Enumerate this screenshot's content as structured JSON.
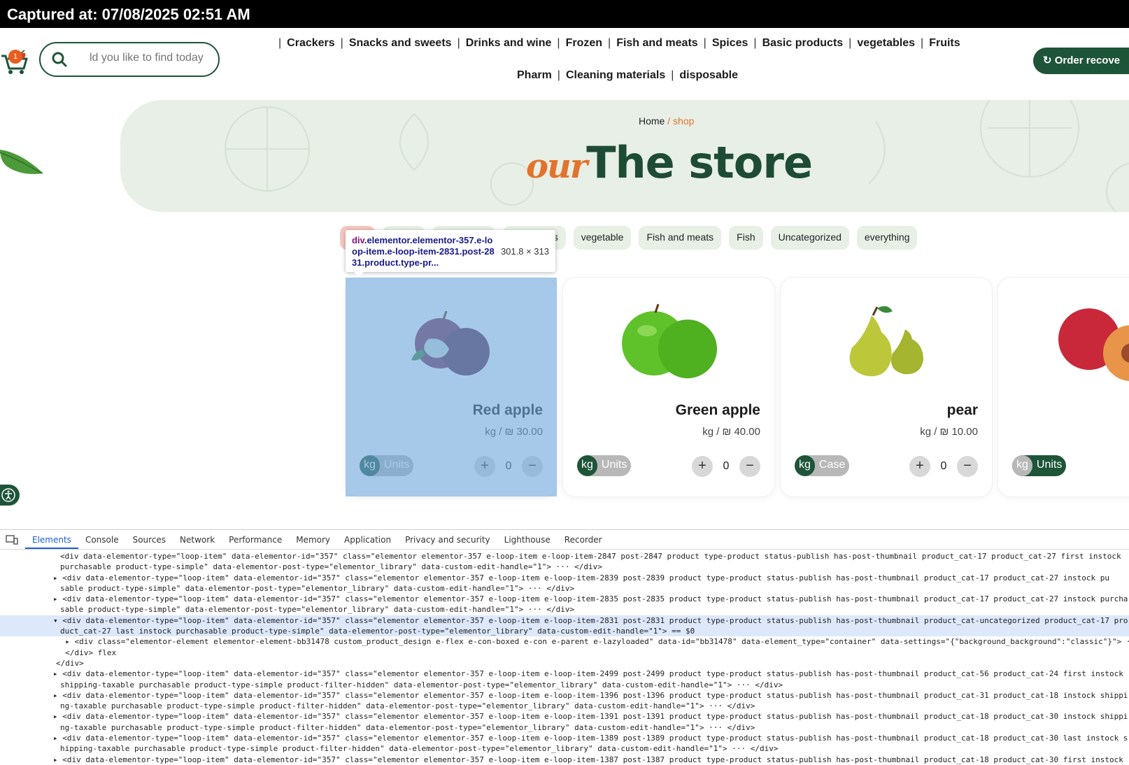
{
  "capture_banner": "Captured at: 07/08/2025 02:51 AM",
  "header": {
    "cart_count": "1",
    "search_placeholder": "ld you like to find today",
    "nav_row1": [
      "Crackers",
      "Snacks and sweets",
      "Drinks and wine",
      "Frozen",
      "Fish and meats",
      "Spices",
      "Basic products",
      "vegetables",
      "Fruits"
    ],
    "nav_row2": [
      "Pharm",
      "Cleaning materials",
      "disposable"
    ],
    "order_button": "Order recove"
  },
  "hero": {
    "breadcrumb_home": "Home",
    "breadcrumb_sep": " / ",
    "breadcrumb_current": "shop",
    "title_our": "our",
    "title_main": "The store"
  },
  "filters": [
    "",
    "",
    "s",
    "vegetables",
    "vegetable",
    "Fish and meats",
    "Fish",
    "Uncategorized",
    "everything"
  ],
  "products": [
    {
      "name": "Red apple",
      "price": "kg / ₪ 30.00",
      "units": [
        "kg",
        "Units"
      ],
      "qty": "0",
      "plus": "+",
      "minus": "−"
    },
    {
      "name": "Green apple",
      "price": "kg / ₪ 40.00",
      "units": [
        "kg",
        "Units"
      ],
      "qty": "0",
      "plus": "+",
      "minus": "−"
    },
    {
      "name": "pear",
      "price": "kg / ₪ 10.00",
      "units": [
        "kg",
        "Case"
      ],
      "qty": "0",
      "plus": "+",
      "minus": "−"
    },
    {
      "name": "",
      "price": "",
      "units": [
        "kg",
        "Units"
      ],
      "qty": "",
      "plus": "",
      "minus": ""
    }
  ],
  "inspector_tooltip": {
    "tag": "div",
    "selector": ".elementor.elementor-357.e-loop-item.e-loop-item-2831.post-2831.product.type-pr...",
    "dims": "301.8 × 313"
  },
  "devtools": {
    "tabs": [
      "Elements",
      "Console",
      "Sources",
      "Network",
      "Performance",
      "Memory",
      "Application",
      "Privacy and security",
      "Lighthouse",
      "Recorder"
    ],
    "lines": [
      "<div data-elementor-type=\"loop-item\" data-elementor-id=\"357\" class=\"elementor elementor-357 e-loop-item e-loop-item-2847 post-2847 product type-product status-publish has-post-thumbnail product_cat-17 product_cat-27 first instock",
      "purchasable product-type-simple\" data-elementor-post-type=\"elementor_library\" data-custom-edit-handle=\"1\"> ··· </div>",
      "▸ <div data-elementor-type=\"loop-item\" data-elementor-id=\"357\" class=\"elementor elementor-357 e-loop-item e-loop-item-2839 post-2839 product type-product status-publish has-post-thumbnail product_cat-17 product_cat-27 instock pu",
      "sable product-type-simple\" data-elementor-post-type=\"elementor_library\" data-custom-edit-handle=\"1\"> ··· </div>",
      "▸ <div data-elementor-type=\"loop-item\" data-elementor-id=\"357\" class=\"elementor elementor-357 e-loop-item e-loop-item-2835 post-2835 product type-product status-publish has-post-thumbnail product_cat-17 product_cat-27 instock purcha",
      "sable product-type-simple\" data-elementor-post-type=\"elementor_library\" data-custom-edit-handle=\"1\"> ··· </div>",
      "▾ <div data-elementor-type=\"loop-item\" data-elementor-id=\"357\" class=\"elementor elementor-357 e-loop-item e-loop-item-2831 post-2831 product type-product status-publish has-post-thumbnail product_cat-uncategorized product_cat-17 pro",
      "duct_cat-27 last instock purchasable product-type-simple\" data-elementor-post-type=\"elementor_library\" data-custom-edit-handle=\"1\"> == $0",
      "  ▸ <div class=\"elementor-element elementor-element-bb31478 custom_product_design e-flex e-con-boxed e-con e-parent e-lazyloaded\" data-id=\"bb31478\" data-element_type=\"container\" data-settings=\"{\"background_background\":\"classic\"}\"> ···",
      "  </div> flex",
      "</div>",
      "▸ <div data-elementor-type=\"loop-item\" data-elementor-id=\"357\" class=\"elementor elementor-357 e-loop-item e-loop-item-2499 post-2499 product type-product status-publish has-post-thumbnail product_cat-56 product_cat-24 first instock",
      "shipping-taxable purchasable product-type-simple product-filter-hidden\" data-elementor-post-type=\"elementor_library\" data-custom-edit-handle=\"1\"> ··· </div>",
      "▸ <div data-elementor-type=\"loop-item\" data-elementor-id=\"357\" class=\"elementor elementor-357 e-loop-item e-loop-item-1396 post-1396 product type-product status-publish has-post-thumbnail product_cat-31 product_cat-18 instock shippi",
      "ng-taxable purchasable product-type-simple product-filter-hidden\" data-elementor-post-type=\"elementor_library\" data-custom-edit-handle=\"1\"> ··· </div>",
      "▸ <div data-elementor-type=\"loop-item\" data-elementor-id=\"357\" class=\"elementor elementor-357 e-loop-item e-loop-item-1391 post-1391 product type-product status-publish has-post-thumbnail product_cat-18 product_cat-30 instock shippi",
      "ng-taxable purchasable product-type-simple product-filter-hidden\" data-elementor-post-type=\"elementor_library\" data-custom-edit-handle=\"1\"> ··· </div>",
      "▸ <div data-elementor-type=\"loop-item\" data-elementor-id=\"357\" class=\"elementor elementor-357 e-loop-item e-loop-item-1389 post-1389 product type-product status-publish has-post-thumbnail product_cat-18 product_cat-30 last instock s",
      "hipping-taxable purchasable product-type-simple product-filter-hidden\" data-elementor-post-type=\"elementor_library\" data-custom-edit-handle=\"1\"> ··· </div>",
      "▸ <div data-elementor-type=\"loop-item\" data-elementor-id=\"357\" class=\"elementor elementor-357 e-loop-item e-loop-item-1387 post-1387 product type-product status-publish has-post-thumbnail product_cat-18 product_cat-30 first instock"
    ]
  },
  "colors": {
    "brand_green": "#1e5438",
    "accent_orange": "#e2732c",
    "hero_bg": "#e7efe6",
    "selection_overlay": "#6fa8dc"
  }
}
